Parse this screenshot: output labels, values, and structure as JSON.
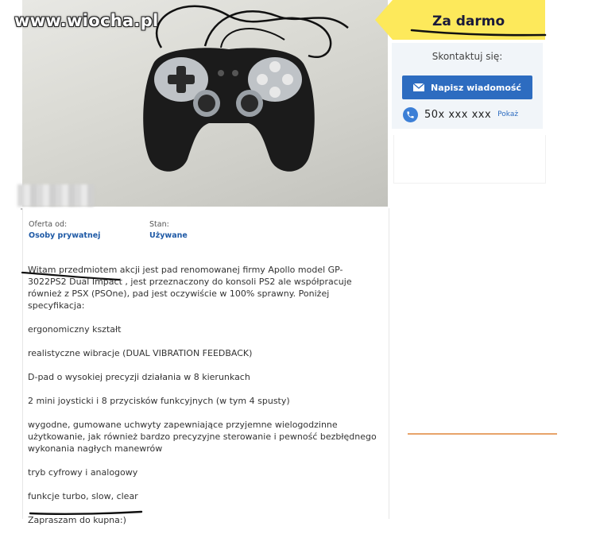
{
  "watermark": "www.wiocha.pl",
  "price": "Za darmo",
  "contact": {
    "label": "Skontaktuj się:",
    "message_button": "Napisz wiadomość",
    "phone": "50x xxx xxx",
    "show_phone": "Pokaż"
  },
  "details": {
    "offer_from_label": "Oferta od:",
    "offer_from_value": "Osoby prywatnej",
    "condition_label": "Stan:",
    "condition_value": "Używane"
  },
  "description": [
    "Witam przedmiotem akcji jest pad renomowanej firmy Apollo model GP-3022PS2 Dual Impact , jest przeznaczony do konsoli PS2 ale współpracuje również z PSX (PSOne), pad jest oczywiście w 100% sprawny. Poniżej specyfikacja:",
    "ergonomiczny kształt",
    "realistyczne wibracje (DUAL VIBRATION FEEDBACK)",
    "D-pad o wysokiej precyzji działania w 8 kierunkach",
    "2 mini joysticki i 8 przycisków funkcyjnych (w tym 4 spusty)",
    "wygodne, gumowane uchwyty zapewniające przyjemne wielogodzinne użytkowanie, jak również bardzo precyzyjne sterowanie i pewność bezbłędnego wykonania nagłych manewrów",
    "tryb cyfrowy i analogowy",
    "funkcje turbo, slow, clear",
    "Zapraszam do kupna:)"
  ],
  "colors": {
    "price_tag": "#fde95b",
    "accent_blue": "#2d6cc0",
    "link_blue": "#1f5aa6"
  }
}
